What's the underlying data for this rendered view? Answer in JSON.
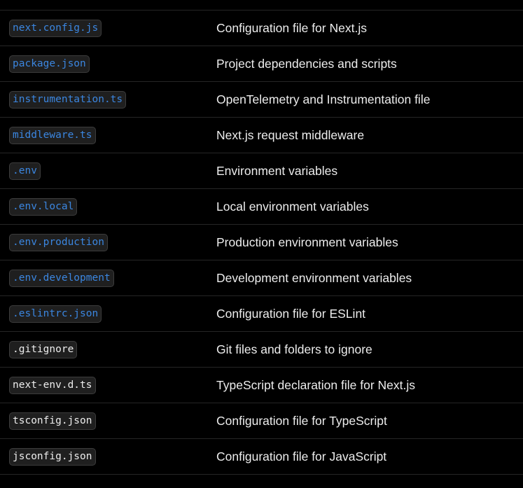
{
  "files_table": {
    "rows": [
      {
        "file": "next.config.js",
        "description": "Configuration file for Next.js",
        "link": true
      },
      {
        "file": "package.json",
        "description": "Project dependencies and scripts",
        "link": true
      },
      {
        "file": "instrumentation.ts",
        "description": "OpenTelemetry and Instrumentation file",
        "link": true
      },
      {
        "file": "middleware.ts",
        "description": "Next.js request middleware",
        "link": true
      },
      {
        "file": ".env",
        "description": "Environment variables",
        "link": true
      },
      {
        "file": ".env.local",
        "description": "Local environment variables",
        "link": true
      },
      {
        "file": ".env.production",
        "description": "Production environment variables",
        "link": true
      },
      {
        "file": ".env.development",
        "description": "Development environment variables",
        "link": true
      },
      {
        "file": ".eslintrc.json",
        "description": "Configuration file for ESLint",
        "link": true
      },
      {
        "file": ".gitignore",
        "description": "Git files and folders to ignore",
        "link": false
      },
      {
        "file": "next-env.d.ts",
        "description": "TypeScript declaration file for Next.js",
        "link": false
      },
      {
        "file": "tsconfig.json",
        "description": "Configuration file for TypeScript",
        "link": false
      },
      {
        "file": "jsconfig.json",
        "description": "Configuration file for JavaScript",
        "link": false
      }
    ]
  },
  "colors": {
    "background": "#000000",
    "link_text": "#3b86e0",
    "plain_text": "#ededed",
    "chip_bg": "#1f1f1f",
    "divider": "#262626"
  }
}
